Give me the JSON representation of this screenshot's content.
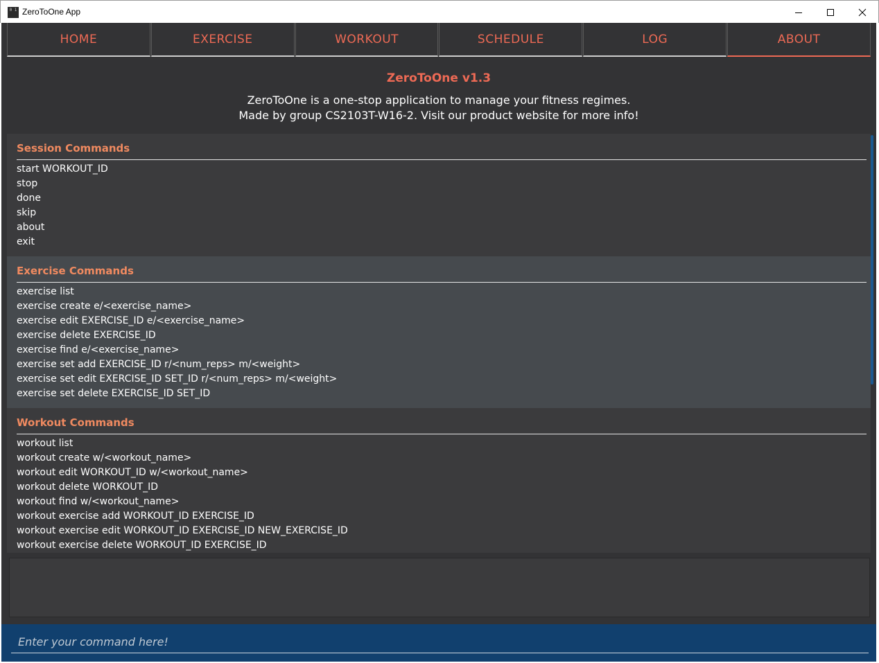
{
  "window": {
    "title": "ZeroToOne App",
    "icon": "app-icon",
    "icon_text": "0 1"
  },
  "tabs": [
    {
      "label": "HOME"
    },
    {
      "label": "EXERCISE"
    },
    {
      "label": "WORKOUT"
    },
    {
      "label": "SCHEDULE"
    },
    {
      "label": "LOG"
    },
    {
      "label": "ABOUT",
      "active": true
    }
  ],
  "about": {
    "title": "ZeroToOne v1.3",
    "line1": "ZeroToOne is a one-stop application to manage your fitness regimes.",
    "line2": "Made by group CS2103T-W16-2. Visit our product website for more info!"
  },
  "sections": [
    {
      "title": "Session Commands",
      "commands": [
        "start WORKOUT_ID",
        "stop",
        "done",
        "skip",
        "about",
        "exit"
      ]
    },
    {
      "title": "Exercise Commands",
      "commands": [
        "exercise list",
        "exercise create e/<exercise_name>",
        "exercise edit EXERCISE_ID e/<exercise_name>",
        "exercise delete EXERCISE_ID",
        "exercise find e/<exercise_name>",
        "exercise set add EXERCISE_ID r/<num_reps> m/<weight>",
        "exercise set edit EXERCISE_ID SET_ID r/<num_reps> m/<weight>",
        "exercise set delete EXERCISE_ID SET_ID"
      ]
    },
    {
      "title": "Workout Commands",
      "commands": [
        "workout list",
        "workout create w/<workout_name>",
        "workout edit WORKOUT_ID w/<workout_name>",
        "workout delete WORKOUT_ID",
        "workout find w/<workout_name>",
        "workout exercise add WORKOUT_ID EXERCISE_ID",
        "workout exercise edit WORKOUT_ID EXERCISE_ID NEW_EXERCISE_ID",
        "workout exercise delete WORKOUT_ID EXERCISE_ID"
      ]
    }
  ],
  "command_box": {
    "placeholder": "Enter your command here!",
    "value": ""
  },
  "colors": {
    "accent": "#ee6a55",
    "background": "#333335",
    "command_bar": "#11406e"
  }
}
